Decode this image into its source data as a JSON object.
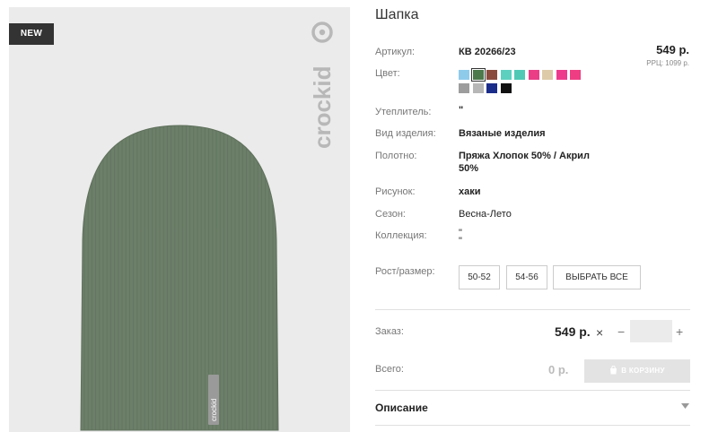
{
  "product": {
    "badge": "NEW",
    "brand_logo_text": "crockid",
    "tag_text": "crockid",
    "title": "Шапка",
    "price": "549 р.",
    "rrp": "РРЦ: 1099 р."
  },
  "specs": {
    "article_label": "Артикул:",
    "article_value": "КВ 20266/23",
    "color_label": "Цвет:",
    "insulation_label": "Утеплитель:",
    "insulation_value": "\"",
    "type_label": "Вид изделия:",
    "type_value": "Вязаные изделия",
    "fabric_label": "Полотно:",
    "fabric_value_line1": "Пряжа Хлопок 50% / Акрил",
    "fabric_value_line2": "50%",
    "pattern_label": "Рисунок:",
    "pattern_value": "хаки",
    "season_label": "Сезон:",
    "season_value": "Весна-Лето",
    "collection_label": "Коллекция:",
    "collection_value_line1": "\"",
    "collection_value_line2": "\""
  },
  "colors": [
    {
      "hex": "#8ecbeb",
      "selected": false
    },
    {
      "hex": "#4c7a4b",
      "selected": true
    },
    {
      "hex": "#8a4b3c",
      "selected": false
    },
    {
      "hex": "#5ed0c0",
      "selected": false
    },
    {
      "hex": "#4fc9b6",
      "selected": false
    },
    {
      "hex": "#ea3d86",
      "selected": false
    },
    {
      "hex": "#dccaa9",
      "selected": false
    },
    {
      "hex": "#ed3a8c",
      "selected": false
    },
    {
      "hex": "#ee3d82",
      "selected": false
    },
    {
      "hex": "#9d9d9d",
      "selected": false
    },
    {
      "hex": "#b7b7b7",
      "selected": false
    },
    {
      "hex": "#1b2d8a",
      "selected": false
    },
    {
      "hex": "#111111",
      "selected": false
    }
  ],
  "sizes": {
    "label": "Рост/размер:",
    "options": [
      "50-52",
      "54-56"
    ],
    "select_all": "ВЫБРАТЬ ВСЕ"
  },
  "order": {
    "label": "Заказ:",
    "unit_price": "549 р.",
    "times": "×",
    "minus": "−",
    "plus": "+",
    "quantity": ""
  },
  "total": {
    "label": "Всего:",
    "value": "0 р.",
    "cart_button": "В КОРЗИНУ"
  },
  "description": {
    "label": "Описание"
  },
  "style_colors": {
    "hat": "#6c7f69",
    "photo_bg": "#ebebeb",
    "badge_bg": "#333333",
    "cart_disabled": "#e3e3e3"
  }
}
